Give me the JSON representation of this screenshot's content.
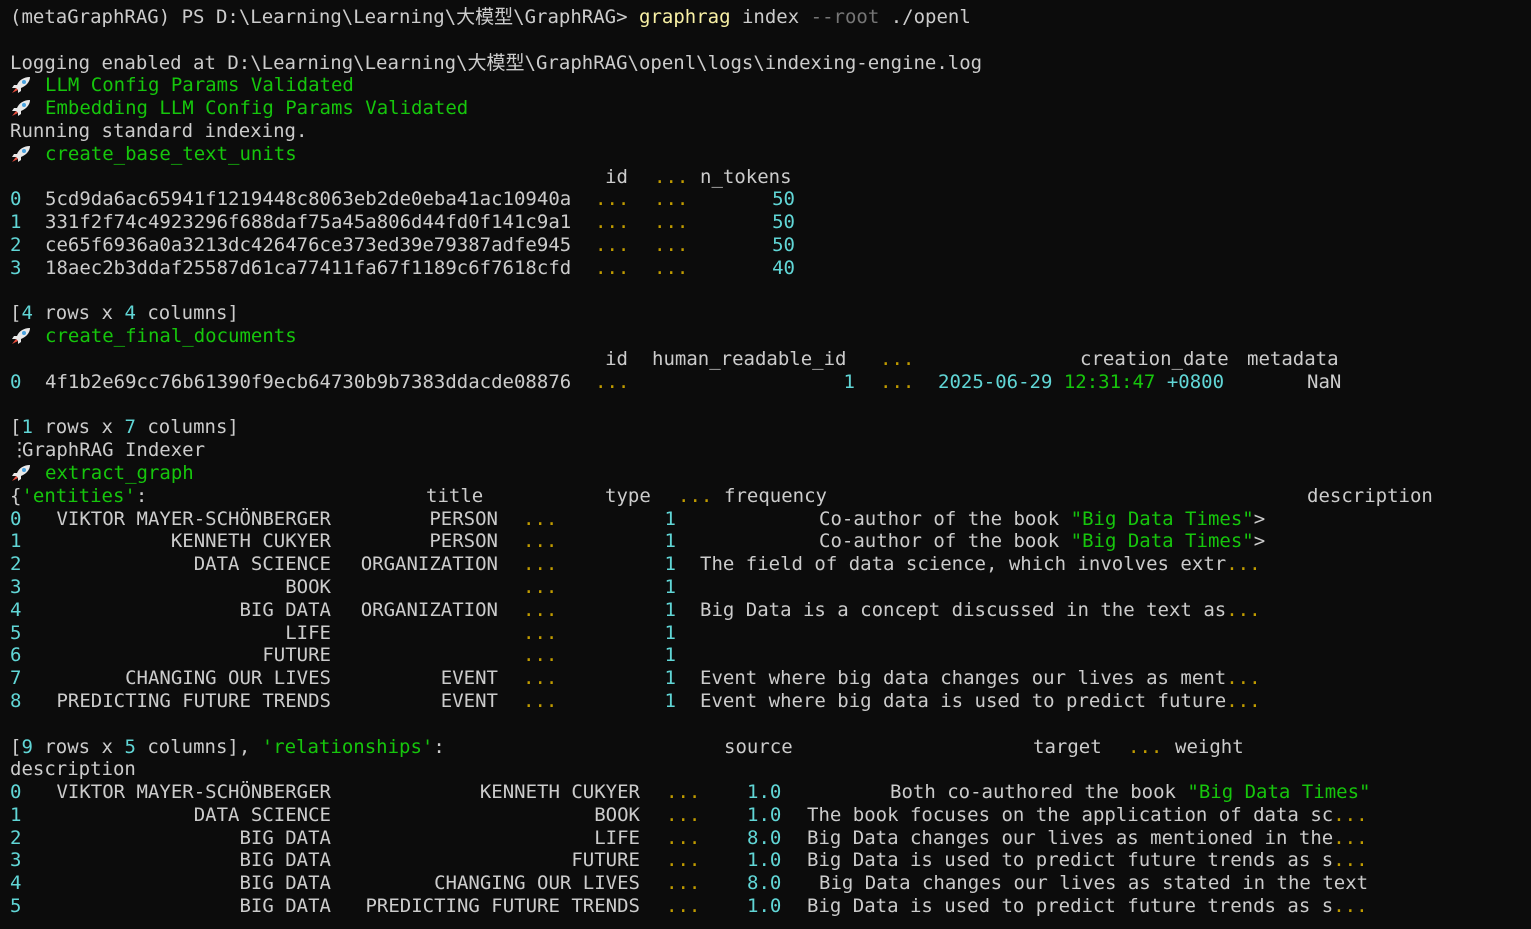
{
  "prompt": {
    "env": "(metaGraphRAG)",
    "ps": "PS",
    "path": "D:\\Learning\\Learning\\大模型\\GraphRAG>",
    "cmd": "graphrag",
    "arg1": "index",
    "flag": "--root",
    "arg2": "./openl"
  },
  "log_line": "Logging enabled at D:\\Learning\\Learning\\大模型\\GraphRAG\\openl\\logs\\indexing-engine.log",
  "steps": {
    "llm_config": "LLM Config Params Validated",
    "embed_config": "Embedding LLM Config Params Validated",
    "running": "Running standard indexing.",
    "text_units": "create_base_text_units",
    "final_docs": "create_final_documents",
    "indexer": "GraphRAG Indexer",
    "extract_graph": "extract_graph"
  },
  "ellipsis": "...",
  "text_units": {
    "headers": {
      "id": "id",
      "ntok": "n_tokens"
    },
    "rows": [
      {
        "idx": "0",
        "id": "5cd9da6ac65941f1219448c8063eb2de0eba41ac10940a",
        "ntok": "50"
      },
      {
        "idx": "1",
        "id": "331f2f74c4923296f688daf75a45a806d44fd0f141c9a1",
        "ntok": "50"
      },
      {
        "idx": "2",
        "id": "ce65f6936a0a3213dc426476ce373ed39e79387adfe945",
        "ntok": "50"
      },
      {
        "idx": "3",
        "id": "18aec2b3ddaf25587d61ca77411fa67f1189c6f7618cfd",
        "ntok": "40"
      }
    ],
    "summary": {
      "rows": "4",
      "rows_label": "rows x",
      "cols": "4",
      "cols_label": "columns]"
    }
  },
  "documents": {
    "headers": {
      "id": "id",
      "hrid": "human_readable_id",
      "cdate": "creation_date",
      "meta": "metadata"
    },
    "row": {
      "idx": "0",
      "id": "4f1b2e69cc76b61390f9ecb64730b9b7383ddacde08876",
      "hrid": "1",
      "date": "2025-06-29",
      "time": "12:31:47",
      "tz": "+0800",
      "meta": "NaN"
    },
    "summary": {
      "rows": "1",
      "rows_label": "rows x",
      "cols": "7",
      "cols_label": "columns]"
    }
  },
  "entities": {
    "key": "'entities'",
    "headers": {
      "title": "title",
      "type": "type",
      "freq": "frequency",
      "desc": "description"
    },
    "rows": [
      {
        "idx": "0",
        "title": "VIKTOR MAYER-SCHÖNBERGER",
        "type": "PERSON",
        "freq": "1",
        "desc": "Co-author of the book ",
        "quote": "\"Big Data Times\"",
        "tail": ">"
      },
      {
        "idx": "1",
        "title": "KENNETH CUKYER",
        "type": "PERSON",
        "freq": "1",
        "desc": "Co-author of the book ",
        "quote": "\"Big Data Times\"",
        "tail": ">"
      },
      {
        "idx": "2",
        "title": "DATA SCIENCE",
        "type": "ORGANIZATION",
        "freq": "1",
        "desc": "The field of data science, which involves extr",
        "tail": "..."
      },
      {
        "idx": "3",
        "title": "BOOK",
        "type": "",
        "freq": "1",
        "desc": "",
        "tail": ""
      },
      {
        "idx": "4",
        "title": "BIG DATA",
        "type": "ORGANIZATION",
        "freq": "1",
        "desc": "Big Data is a concept discussed in the text as",
        "tail": "..."
      },
      {
        "idx": "5",
        "title": "LIFE",
        "type": "",
        "freq": "1",
        "desc": "",
        "tail": ""
      },
      {
        "idx": "6",
        "title": "FUTURE",
        "type": "",
        "freq": "1",
        "desc": "",
        "tail": ""
      },
      {
        "idx": "7",
        "title": "CHANGING OUR LIVES",
        "type": "EVENT",
        "freq": "1",
        "desc": "Event where big data changes our lives as ment",
        "tail": "..."
      },
      {
        "idx": "8",
        "title": "PREDICTING FUTURE TRENDS",
        "type": "EVENT",
        "freq": "1",
        "desc": "Event where big data is used to predict future",
        "tail": "..."
      }
    ],
    "summary": {
      "rows": "9",
      "rows_label": "rows x",
      "cols": "5",
      "cols_label": "columns],"
    }
  },
  "relationships": {
    "key": "'relationships'",
    "headers": {
      "source": "source",
      "target": "target",
      "weight": "weight",
      "desc": "description"
    },
    "rows": [
      {
        "idx": "0",
        "source": "VIKTOR MAYER-SCHÖNBERGER",
        "target": "KENNETH CUKYER",
        "weight": "1.0",
        "desc": "Both co-authored the book ",
        "quote": "\"Big Data Times\"",
        "tail": ""
      },
      {
        "idx": "1",
        "source": "DATA SCIENCE",
        "target": "BOOK",
        "weight": "1.0",
        "desc": "The book focuses on the application of data sc",
        "tail": "..."
      },
      {
        "idx": "2",
        "source": "BIG DATA",
        "target": "LIFE",
        "weight": "8.0",
        "desc": "Big Data changes our lives as mentioned in the",
        "tail": "..."
      },
      {
        "idx": "3",
        "source": "BIG DATA",
        "target": "FUTURE",
        "weight": "1.0",
        "desc": "Big Data is used to predict future trends as s",
        "tail": "..."
      },
      {
        "idx": "4",
        "source": "BIG DATA",
        "target": "CHANGING OUR LIVES",
        "weight": "8.0",
        "desc": "Big Data changes our lives as stated in the text",
        "tail": ""
      },
      {
        "idx": "5",
        "source": "BIG DATA",
        "target": "PREDICTING FUTURE TRENDS",
        "weight": "1.0",
        "desc": "Big Data is used to predict future trends as s",
        "tail": "..."
      }
    ]
  },
  "colors": {
    "background": "#0c0c0c",
    "text": "#cccccc",
    "green": "#16c60c",
    "cyan": "#61d6d6",
    "yellow": "#f9f1a5",
    "gold": "#c19c00"
  },
  "icons": {
    "step": "rocket-icon",
    "menu": "vertical-ellipsis-icon"
  }
}
